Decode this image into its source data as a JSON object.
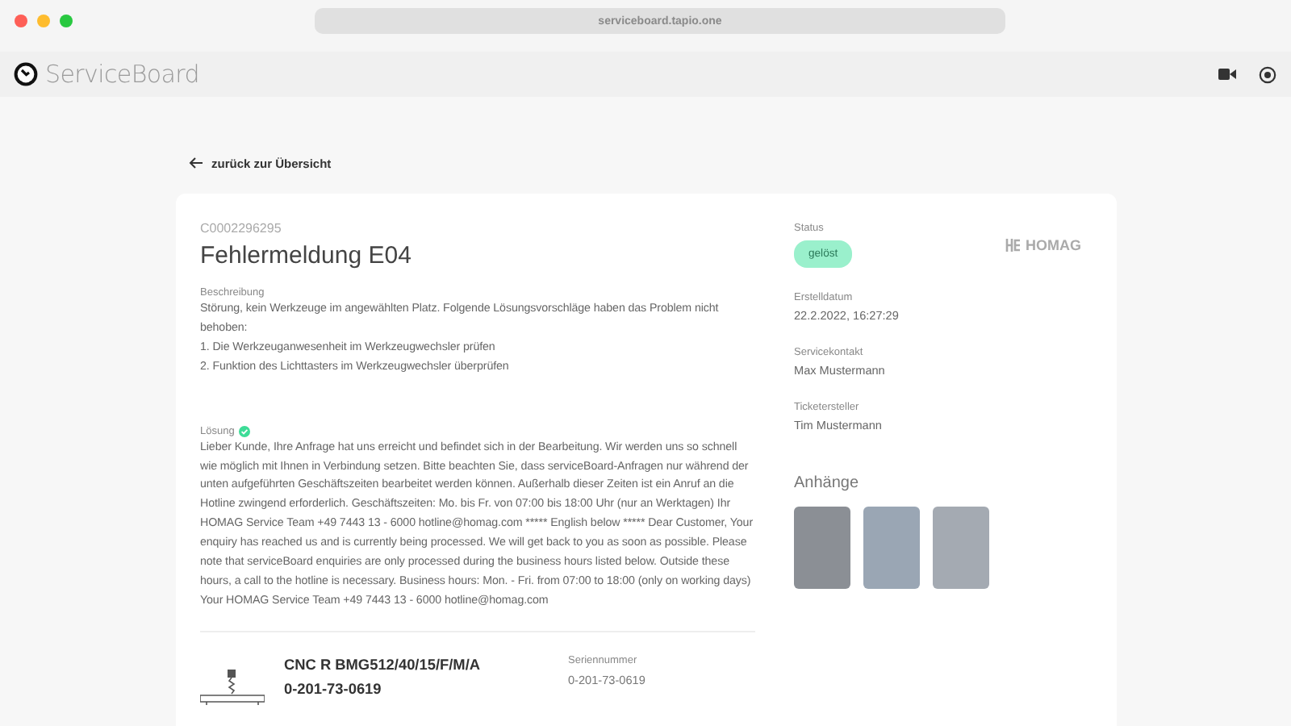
{
  "browser": {
    "url": "serviceboard.tapio.one"
  },
  "app": {
    "name": "ServiceBoard"
  },
  "back_link": {
    "label": "zurück zur Übersicht"
  },
  "ticket": {
    "id": "C0002296295",
    "title": "Fehlermeldung E04",
    "description": {
      "label": "Beschreibung",
      "lines": [
        "Störung, kein Werkzeuge im angewählten Platz. Folgende Lösungsvorschläge haben das Problem nicht behoben:",
        "1. Die Werkzeuganwesenheit im Werkzeugwechsler prüfen",
        "2. Funktion des Lichttasters im Werkzeugwechsler überprüfen"
      ]
    },
    "solution": {
      "label": "Lösung",
      "resolved": true,
      "text": "Lieber Kunde, Ihre Anfrage hat uns erreicht und befindet sich in der Bearbeitung. Wir werden uns so schnell wie möglich mit Ihnen in Verbindung setzen. Bitte beachten Sie, dass serviceBoard-Anfragen nur während der unten aufgeführten Geschäftszeiten bearbeitet werden können. Außerhalb dieser Zeiten ist ein Anruf an die Hotline zwingend erforderlich. Geschäftszeiten: Mo. bis Fr. von 07:00 bis 18:00 Uhr (nur an Werktagen) Ihr HOMAG Service Team +49 7443 13 - 6000 hotline@homag.com ***** English below ***** Dear Customer, Your enquiry has reached us and is currently being processed. We will get back to you as soon as possible. Please note that serviceBoard enquiries are only processed during the business hours listed below. Outside these hours, a call to the hotline is necessary. Business hours: Mon. - Fri. from 07:00 to 18:00 (only on working days) Your HOMAG Service Team +49 7443 13 - 6000 hotline@homag.com"
    },
    "machine": {
      "name": "CNC R BMG512/40/15/F/M/A",
      "number": "0-201-73-0619",
      "serial_label": "Seriennummer",
      "serial": "0-201-73-0619"
    }
  },
  "side": {
    "status": {
      "label": "Status",
      "value": "gelöst",
      "resolved": true
    },
    "brand": "HOMAG",
    "fields": [
      {
        "label": "Erstelldatum",
        "value": "22.2.2022, 16:27:29"
      },
      {
        "label": "Servicekontakt",
        "value": "Max Mustermann"
      },
      {
        "label": "Ticketersteller",
        "value": "Tim Mustermann"
      }
    ],
    "attachments": {
      "title": "Anhänge",
      "items": [
        {
          "kind": "photo"
        },
        {
          "kind": "photo"
        },
        {
          "kind": "photo"
        }
      ]
    }
  }
}
